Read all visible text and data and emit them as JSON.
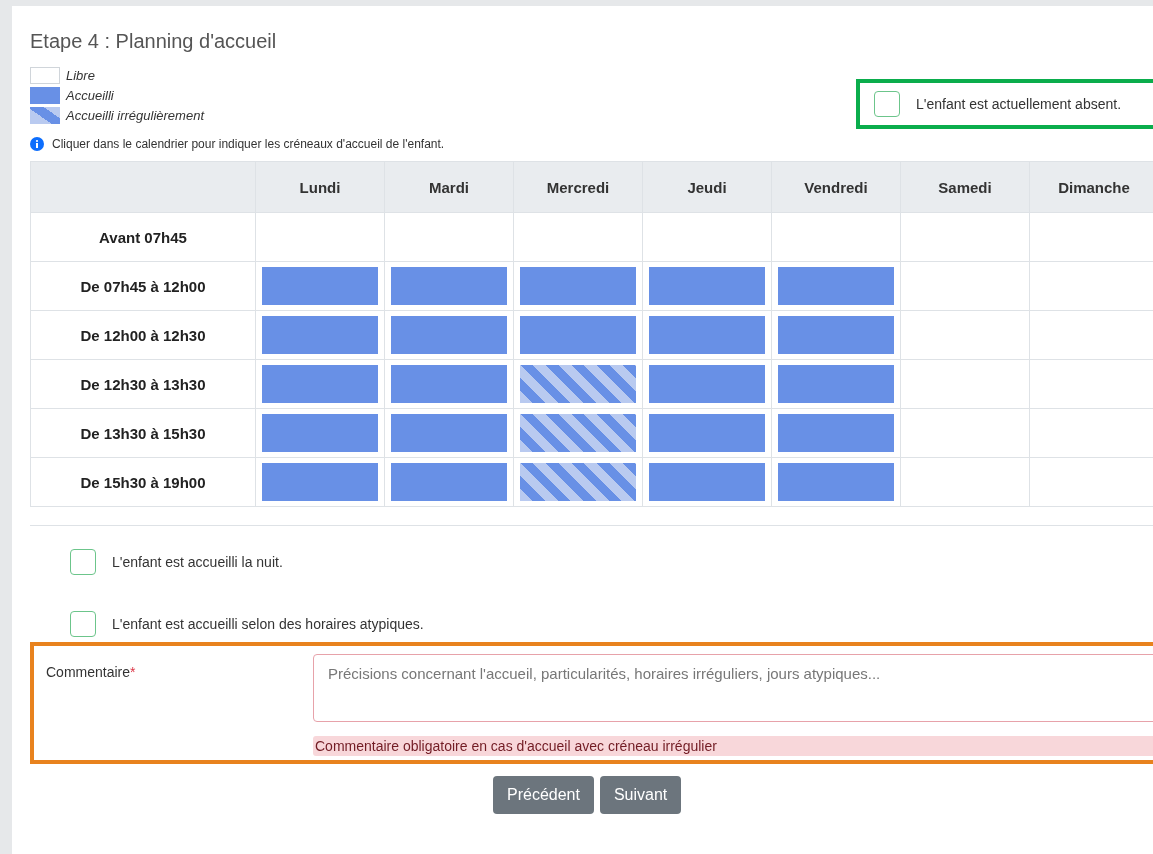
{
  "title": "Etape 4 : Planning d'accueil",
  "legend": [
    {
      "kind": "free",
      "label": "Libre"
    },
    {
      "kind": "regular",
      "label": "Accueilli"
    },
    {
      "kind": "irregular",
      "label": "Accueilli irrégulièrement"
    }
  ],
  "absent_checkbox": {
    "label": "L'enfant est actuellement absent.",
    "checked": false
  },
  "info": "Cliquer dans le calendrier pour indiquer les créneaux d'accueil de l'enfant.",
  "table": {
    "columns": [
      "Lundi",
      "Mardi",
      "Mercredi",
      "Jeudi",
      "Vendredi",
      "Samedi",
      "Dimanche"
    ],
    "rows": [
      {
        "label": "Avant 07h45",
        "cells": [
          {
            "booked": false,
            "irregular": false
          },
          {
            "booked": false,
            "irregular": false
          },
          {
            "booked": false,
            "irregular": false
          },
          {
            "booked": false,
            "irregular": false
          },
          {
            "booked": false,
            "irregular": false
          },
          {
            "booked": false,
            "irregular": false
          },
          {
            "booked": false,
            "irregular": false
          }
        ]
      },
      {
        "label": "De 07h45 à 12h00",
        "cells": [
          {
            "booked": true,
            "irregular": false
          },
          {
            "booked": true,
            "irregular": false
          },
          {
            "booked": true,
            "irregular": false
          },
          {
            "booked": true,
            "irregular": false
          },
          {
            "booked": true,
            "irregular": false
          },
          {
            "booked": false,
            "irregular": false
          },
          {
            "booked": false,
            "irregular": false
          }
        ]
      },
      {
        "label": "De 12h00 à 12h30",
        "cells": [
          {
            "booked": true,
            "irregular": false
          },
          {
            "booked": true,
            "irregular": false
          },
          {
            "booked": true,
            "irregular": false
          },
          {
            "booked": true,
            "irregular": false
          },
          {
            "booked": true,
            "irregular": false
          },
          {
            "booked": false,
            "irregular": false
          },
          {
            "booked": false,
            "irregular": false
          }
        ]
      },
      {
        "label": "De 12h30 à 13h30",
        "cells": [
          {
            "booked": true,
            "irregular": false
          },
          {
            "booked": true,
            "irregular": false
          },
          {
            "booked": true,
            "irregular": true
          },
          {
            "booked": true,
            "irregular": false
          },
          {
            "booked": true,
            "irregular": false
          },
          {
            "booked": false,
            "irregular": false
          },
          {
            "booked": false,
            "irregular": false
          }
        ]
      },
      {
        "label": "De 13h30 à 15h30",
        "cells": [
          {
            "booked": true,
            "irregular": false
          },
          {
            "booked": true,
            "irregular": false
          },
          {
            "booked": true,
            "irregular": true
          },
          {
            "booked": true,
            "irregular": false
          },
          {
            "booked": true,
            "irregular": false
          },
          {
            "booked": false,
            "irregular": false
          },
          {
            "booked": false,
            "irregular": false
          }
        ]
      },
      {
        "label": "De 15h30 à 19h00",
        "cells": [
          {
            "booked": true,
            "irregular": false
          },
          {
            "booked": true,
            "irregular": false
          },
          {
            "booked": true,
            "irregular": true
          },
          {
            "booked": true,
            "irregular": false
          },
          {
            "booked": true,
            "irregular": false
          },
          {
            "booked": false,
            "irregular": false
          },
          {
            "booked": false,
            "irregular": false
          }
        ]
      }
    ]
  },
  "options": [
    {
      "label": "L'enfant est accueilli la nuit.",
      "checked": false
    },
    {
      "label": "L'enfant est accueilli selon des horaires atypiques.",
      "checked": false
    }
  ],
  "comment": {
    "label": "Commentaire",
    "required_mark": "*",
    "placeholder": "Précisions concernant l'accueil, particularités, horaires irréguliers, jours atypiques...",
    "error": "Commentaire obligatoire en cas d'accueil avec créneau irrégulier"
  },
  "buttons": [
    "Précédent",
    "Suivant"
  ]
}
